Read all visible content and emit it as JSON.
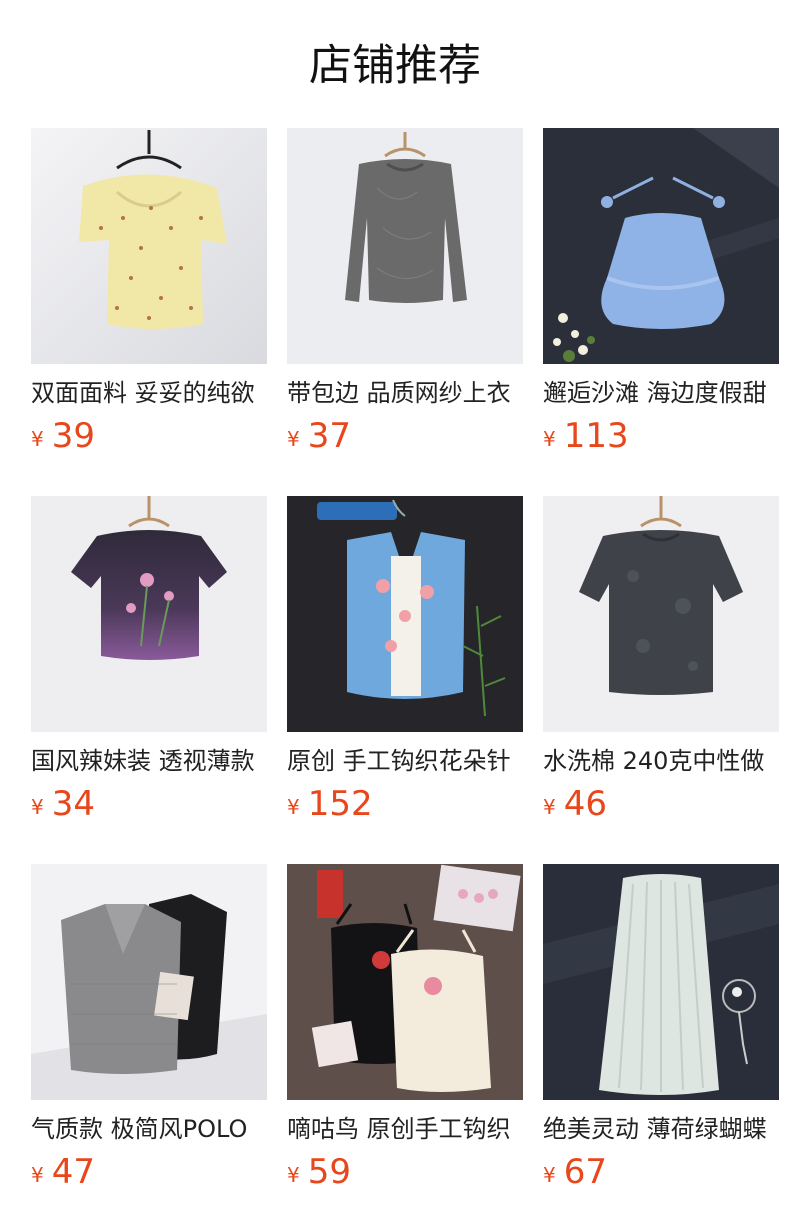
{
  "page": {
    "title": "店铺推荐"
  },
  "currency_symbol": "¥",
  "products": [
    {
      "name": "双面面料 妥妥的纯欲",
      "price": "39",
      "image": "yellow-floral-top-on-hanger"
    },
    {
      "name": "带包边 品质网纱上衣",
      "price": "37",
      "image": "gray-mesh-long-sleeve-top-on-hanger"
    },
    {
      "name": "邂逅沙滩 海边度假甜",
      "price": "113",
      "image": "blue-halter-ruffle-top-flatlay"
    },
    {
      "name": "国风辣妹装 透视薄款",
      "price": "34",
      "image": "purple-floral-mesh-tee-on-hanger"
    },
    {
      "name": "原创 手工钩织花朵针",
      "price": "152",
      "image": "blue-crochet-vest-with-flowers"
    },
    {
      "name": "水洗棉 240克中性做",
      "price": "46",
      "image": "washed-charcoal-tee-on-hanger"
    },
    {
      "name": "气质款 极简风POLO",
      "price": "47",
      "image": "gray-and-black-knit-polo-vests"
    },
    {
      "name": "嘀咕鸟 原创手工钩织",
      "price": "59",
      "image": "black-and-cream-knit-camisoles"
    },
    {
      "name": "绝美灵动 薄荷绿蝴蝶",
      "price": "67",
      "image": "mint-pleated-skirt-flatlay"
    }
  ]
}
